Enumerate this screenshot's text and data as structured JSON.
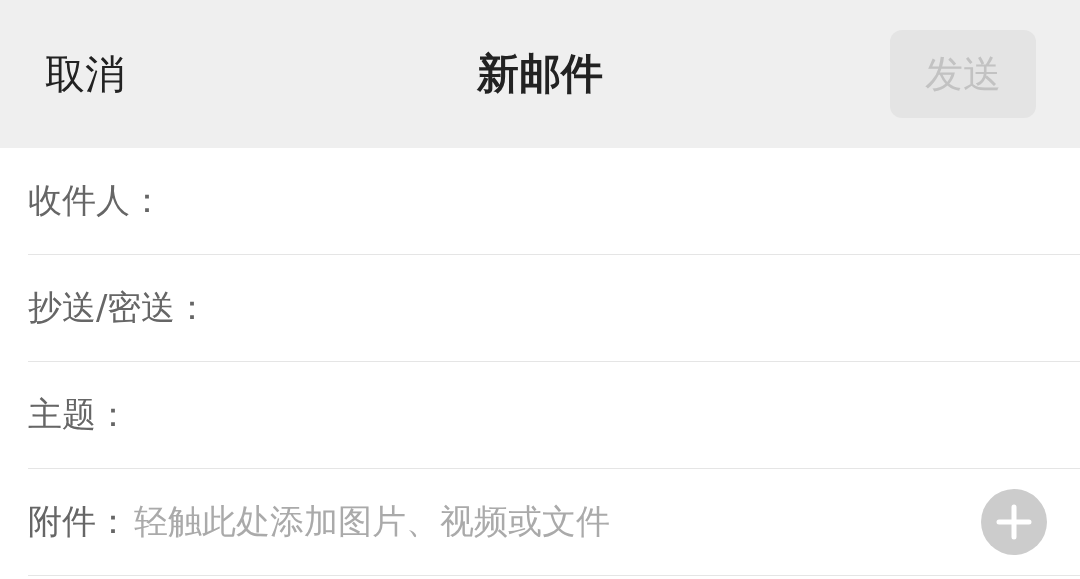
{
  "nav": {
    "cancel": "取消",
    "title": "新邮件",
    "send": {
      "label": "发送",
      "disabled": true
    }
  },
  "fields": [
    {
      "kind": "text",
      "label": "收件人："
    },
    {
      "kind": "text",
      "label": "抄送/密送："
    },
    {
      "kind": "text",
      "label": "主题："
    },
    {
      "kind": "attachment",
      "label": "附件：",
      "placeholder": "轻触此处添加图片、视频或文件"
    }
  ]
}
